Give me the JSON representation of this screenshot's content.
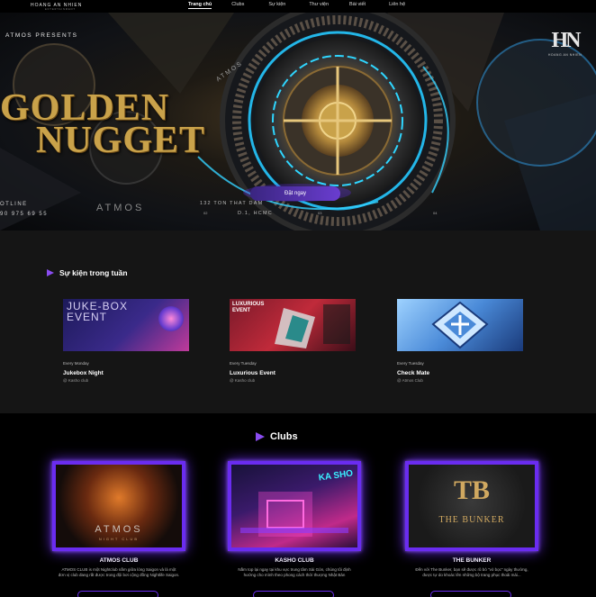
{
  "header": {
    "brand": "HOANG AN NHIEN",
    "brand_sub": "ENTERTAINMENT",
    "nav": [
      {
        "label": "Trang chủ",
        "active": true
      },
      {
        "label": "Clubs",
        "active": false
      },
      {
        "label": "Sự kiện",
        "active": false
      },
      {
        "label": "Thư viện",
        "active": false
      },
      {
        "label": "Bài viết",
        "active": false
      },
      {
        "label": "Liên hệ",
        "active": false
      }
    ]
  },
  "hero": {
    "presents": "ATMOS PRESENTS",
    "title_line1": "GOLDEN",
    "title_line2": "NUGGET",
    "book_button": "Đặt ngay",
    "hotline_label": "OTLINE",
    "hotline_number": "90 975 69 55",
    "atmos_label": "ATMOS",
    "address_line1": "132 TON THAT DAM",
    "address_line2": "D.1, HCMC",
    "numbers": [
      "02",
      "03",
      "04"
    ],
    "disc_text": "ATMOS",
    "logo_mark": "HN",
    "logo_text": "HOANG AN NHIEN"
  },
  "events": {
    "heading": "Sự kiện trong tuần",
    "items": [
      {
        "when": "Every Monday",
        "name": "Jukebox Night",
        "venue": "@ Kasho club",
        "art_title": "JUKE-BOX EVENT"
      },
      {
        "when": "Every Tuesday",
        "name": "Luxurious Event",
        "venue": "@ Kasho club",
        "art_title": "LUXURIOUS EVENT"
      },
      {
        "when": "Every Tuesday",
        "name": "Check Mate",
        "venue": "@ Atmos Club",
        "art_title": ""
      }
    ]
  },
  "clubs": {
    "heading": "Clubs",
    "items": [
      {
        "name": "ATMOS CLUB",
        "desc": "ATMOS CLUB is một Nightclub nằm giữa lòng Saigon và là một đơn vị club đang rất được trong đội bơi cộng đồng Nightlife Saigon.",
        "art_title": "ATMOS",
        "art_sub": "NIGHT CLUB"
      },
      {
        "name": "KASHO CLUB",
        "desc": "Nằm top lại ngay tại khu vực trung tâm Sài Gòn, chúng tôi định hướng cho mình theo phong cách thời thượng Nhật Bản",
        "art_title": "KA SHO"
      },
      {
        "name": "THE BUNKER",
        "desc": "Đến với The Bunker, bạn sẽ được rũ bỏ \"vỏ bọc\" ngày thường, được tự do khoác lên những bộ trang phục thoải mái...",
        "art_title": "THE BUNKER"
      }
    ]
  },
  "colors": {
    "accent": "#6a2cf0",
    "gold": "#c9a24a",
    "events_bg": "#151515"
  }
}
